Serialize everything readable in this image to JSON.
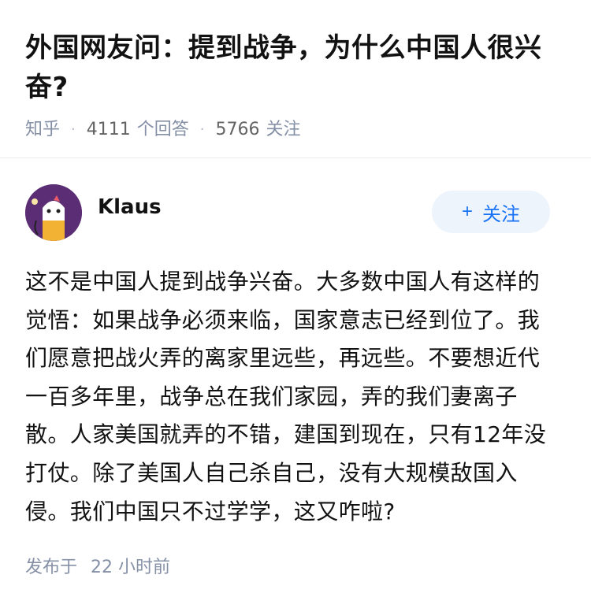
{
  "question": {
    "title": "外国网友问：提到战争，为什么中国人很兴奋?",
    "source": "知乎",
    "separator": "·",
    "answer_count": "4111",
    "answer_label": "个回答",
    "follower_count": "5766",
    "follower_label": "关注"
  },
  "author": {
    "name": "Klaus",
    "follow_label": "关注",
    "follow_icon": "plus-icon"
  },
  "answer": {
    "text": "这不是中国人提到战争兴奋。大多数中国人有这样的觉悟：如果战争必须来临，国家意志已经到位了。我们愿意把战火弄的离家里远些，再远些。不要想近代一百多年里，战争总在我们家园，弄的我们妻离子散。人家美国就弄的不错，建国到现在，只有12年没打仗。除了美国人自己杀自己，没有大规模敌国入侵。我们中国只不过学学，这又咋啦?"
  },
  "footer": {
    "published_label": "发布于",
    "published_time": "22 小时前"
  },
  "colors": {
    "accent": "#1772f6",
    "follow_bg": "#eef4fc",
    "meta_text": "#8590a6",
    "avatar_bg": "#5b2d74"
  }
}
